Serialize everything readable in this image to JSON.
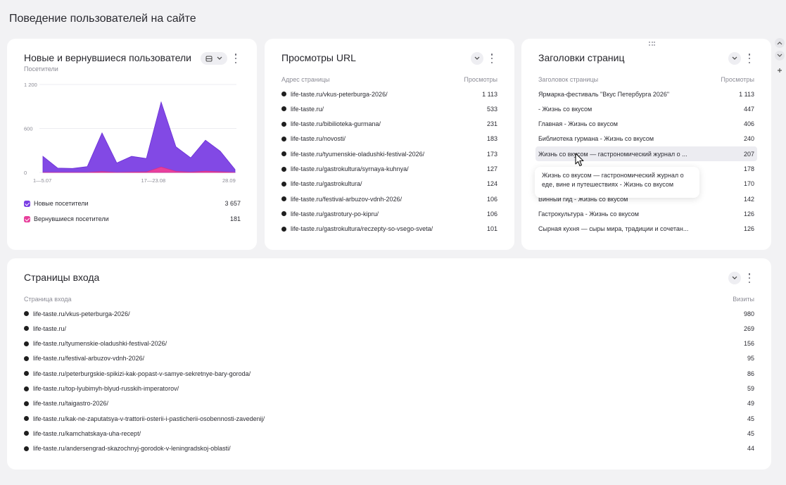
{
  "page": {
    "title": "Поведение пользователей на сайте"
  },
  "colors": {
    "new_users": "#7b3fe4",
    "returning_users": "#e8409c",
    "highlight_row": "#ececf1"
  },
  "users_card": {
    "title": "Новые и вернувшиеся пользователи",
    "subtitle": "Посетители",
    "y_ticks": [
      "1 200",
      "600",
      "0"
    ],
    "x_ticks": [
      "1—5.07",
      "17—23.08",
      "28.09"
    ],
    "legend": [
      {
        "label": "Новые посетители",
        "value": "3 657"
      },
      {
        "label": "Вернувшиеся посетители",
        "value": "181"
      }
    ]
  },
  "chart_data": {
    "type": "area",
    "title": "Новые и вернувшиеся пользователи",
    "ylabel": "Посетители",
    "ylim": [
      0,
      1200
    ],
    "x_tick_labels": [
      "1—5.07",
      "17—23.08",
      "28.09"
    ],
    "series": [
      {
        "name": "Новые посетители",
        "values": [
          220,
          60,
          55,
          80,
          540,
          130,
          220,
          190,
          960,
          350,
          200,
          440,
          290,
          40
        ]
      },
      {
        "name": "Вернувшиеся посетители",
        "values": [
          0,
          0,
          0,
          0,
          12,
          0,
          5,
          8,
          75,
          15,
          5,
          18,
          10,
          0
        ]
      }
    ],
    "grid": true
  },
  "urls_card": {
    "title": "Просмотры URL",
    "col_label": "Адрес страницы",
    "col_value": "Просмотры",
    "rows": [
      {
        "label": "life-taste.ru/vkus-peterburga-2026/",
        "value": "1 113"
      },
      {
        "label": "life-taste.ru/",
        "value": "533"
      },
      {
        "label": "life-taste.ru/bibilioteka-gurmana/",
        "value": "231"
      },
      {
        "label": "life-taste.ru/novosti/",
        "value": "183"
      },
      {
        "label": "life-taste.ru/tyumenskie-oladushki-festival-2026/",
        "value": "173"
      },
      {
        "label": "life-taste.ru/gastrokultura/syrnaya-kuhnya/",
        "value": "127"
      },
      {
        "label": "life-taste.ru/gastrokultura/",
        "value": "124"
      },
      {
        "label": "life-taste.ru/festival-arbuzov-vdnh-2026/",
        "value": "106"
      },
      {
        "label": "life-taste.ru/gastrotury-po-kipru/",
        "value": "106"
      },
      {
        "label": "life-taste.ru/gastrokultura/reczepty-so-vsego-sveta/",
        "value": "101"
      }
    ]
  },
  "titles_card": {
    "title": "Заголовки страниц",
    "col_label": "Заголовок страницы",
    "col_value": "Просмотры",
    "rows": [
      {
        "label": "Ярмарка-фестиваль \"Вкус Петербурга 2026\"",
        "value": "1 113"
      },
      {
        "label": "- Жизнь со вкусом",
        "value": "447"
      },
      {
        "label": "Главная - Жизнь со вкусом",
        "value": "406"
      },
      {
        "label": "Библиотека гурмана - Жизнь со вкусом",
        "value": "240"
      },
      {
        "label": "Жизнь со вкусом — гастрономический журнал о ...",
        "value": "207"
      },
      {
        "label": "",
        "value": "178"
      },
      {
        "label": "",
        "value": "170"
      },
      {
        "label": "Винный гид - Жизнь со вкусом",
        "value": "142"
      },
      {
        "label": "Гастрокультура - Жизнь со вкусом",
        "value": "126"
      },
      {
        "label": "Сырная кухня — сыры мира, традиции и сочетан...",
        "value": "126"
      }
    ],
    "tooltip": "Жизнь со вкусом — гастрономический журнал о еде, вине и путешествиях - Жизнь со вкусом"
  },
  "entry_card": {
    "title": "Страницы входа",
    "col_label": "Страница входа",
    "col_value": "Визиты",
    "rows": [
      {
        "label": "life-taste.ru/vkus-peterburga-2026/",
        "value": "980"
      },
      {
        "label": "life-taste.ru/",
        "value": "269"
      },
      {
        "label": "life-taste.ru/tyumenskie-oladushki-festival-2026/",
        "value": "156"
      },
      {
        "label": "life-taste.ru/festival-arbuzov-vdnh-2026/",
        "value": "95"
      },
      {
        "label": "life-taste.ru/peterburgskie-spikizi-kak-popast-v-samye-sekretnye-bary-goroda/",
        "value": "86"
      },
      {
        "label": "life-taste.ru/top-lyubimyh-blyud-russkih-imperatorov/",
        "value": "59"
      },
      {
        "label": "life-taste.ru/taigastro-2026/",
        "value": "49"
      },
      {
        "label": "life-taste.ru/kak-ne-zaputatsya-v-trattorii-osterii-i-pasticherii-osobennosti-zavedenij/",
        "value": "45"
      },
      {
        "label": "life-taste.ru/kamchatskaya-uha-recept/",
        "value": "45"
      },
      {
        "label": "life-taste.ru/andersengrad-skazochnyj-gorodok-v-leningradskoj-oblasti/",
        "value": "44"
      }
    ]
  }
}
